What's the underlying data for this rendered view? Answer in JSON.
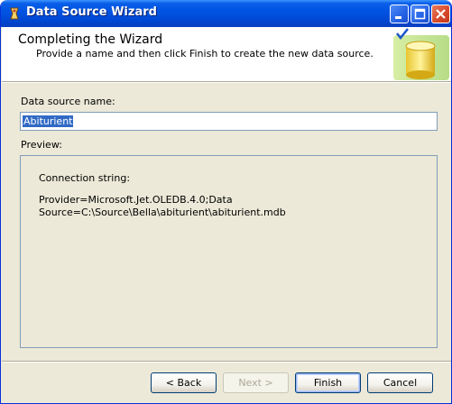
{
  "window": {
    "title": "Data Source Wizard",
    "icon": "wizard-app-icon"
  },
  "header": {
    "title": "Completing the Wizard",
    "subtitle": "Provide a name and then click Finish to create the new data source.",
    "graphic": "database-check-icon"
  },
  "form": {
    "name_label": "Data source name:",
    "name_value": "Abiturient",
    "preview_label": "Preview:"
  },
  "preview": {
    "heading": "Connection string:",
    "lines": [
      "Provider=Microsoft.Jet.OLEDB.4.0;Data",
      "Source=C:\\Source\\Bella\\abiturient\\abiturient.mdb"
    ]
  },
  "buttons": {
    "back": "< Back",
    "next": "Next >",
    "finish": "Finish",
    "cancel": "Cancel"
  },
  "colors": {
    "titlebar": "#0054e3",
    "dialog_bg": "#ece9d8",
    "selection": "#316ac5"
  }
}
